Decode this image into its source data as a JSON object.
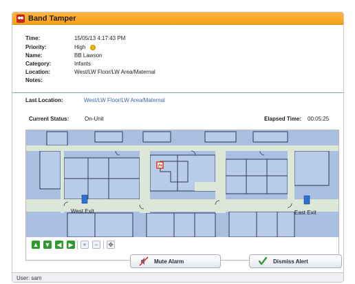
{
  "window": {
    "title": "Band Tamper"
  },
  "details": {
    "time_label": "Time:",
    "time_value": "15/05/13 4:17:43 PM",
    "priority_label": "Priority:",
    "priority_value": "High",
    "name_label": "Name:",
    "name_value": "BB Lawson",
    "category_label": "Category:",
    "category_value": "Infants",
    "location_label": "Location:",
    "location_value": "West/LW Floor/LW Area/Maternal",
    "notes_label": "Notes:",
    "notes_value": ""
  },
  "status": {
    "last_location_label": "Last Location:",
    "last_location_value": "West/LW Floor/LW Area/Maternal",
    "current_status_label": "Current Status:",
    "current_status_value": "On-Unit",
    "elapsed_label": "Elapsed Time:",
    "elapsed_value": "00:05:25"
  },
  "map": {
    "exit_west": "West Exit",
    "exit_east": "East Exit"
  },
  "actions": {
    "mute_label": "Mute Alarm",
    "dismiss_label": "Dismiss Alert"
  },
  "footer": {
    "user_text": "User: sam"
  },
  "colors": {
    "title_bar": "#f6a018",
    "floor_wall": "#a9bfe0",
    "corridor": "#dce7d8",
    "link_text": "#3d64b0",
    "alert_marker": "#e2361c"
  }
}
